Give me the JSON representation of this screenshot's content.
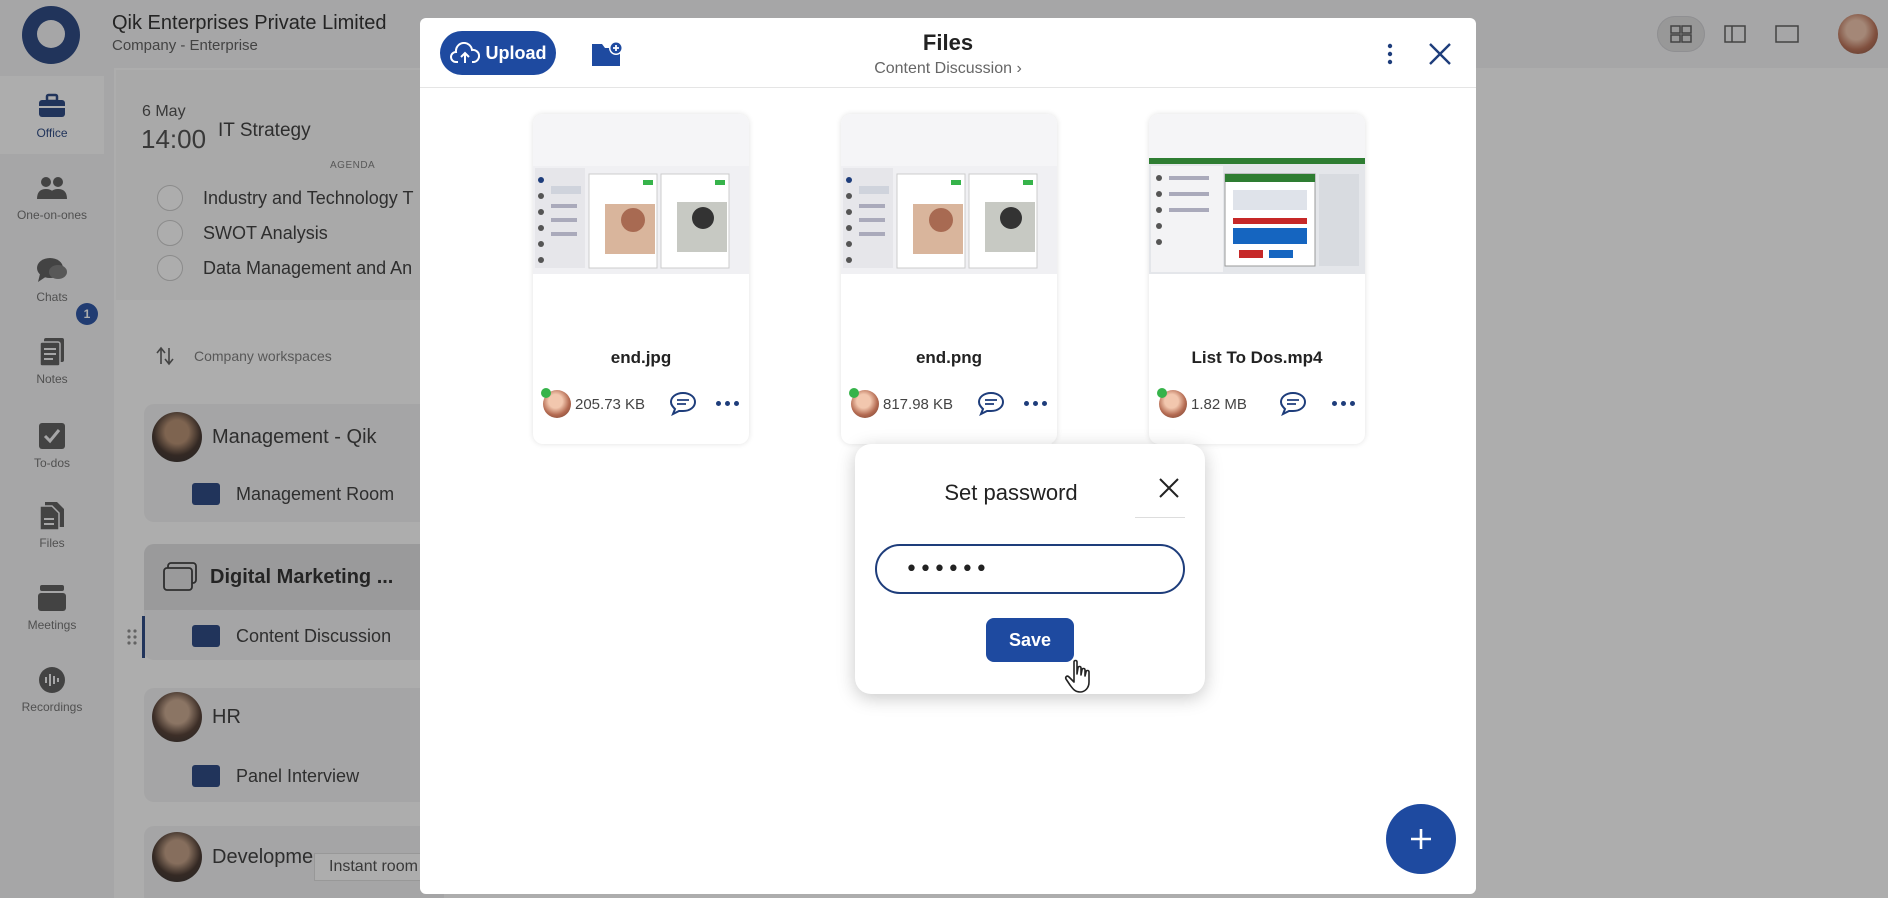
{
  "topbar": {
    "company_name": "Qik Enterprises Private Limited",
    "company_type": "Company - Enterprise",
    "view_icons": [
      "grid-view-icon",
      "sidebar-view-icon",
      "single-view-icon"
    ]
  },
  "sidebar": {
    "items": [
      {
        "label": "Office",
        "icon": "briefcase-icon"
      },
      {
        "label": "One-on-ones",
        "icon": "people-icon"
      },
      {
        "label": "Chats",
        "icon": "chat-icon"
      },
      {
        "label": "Notes",
        "icon": "notes-icon"
      },
      {
        "label": "To-dos",
        "icon": "todo-icon"
      },
      {
        "label": "Files",
        "icon": "files-icon"
      },
      {
        "label": "Meetings",
        "icon": "meetings-icon"
      },
      {
        "label": "Recordings",
        "icon": "recordings-icon"
      }
    ],
    "chat_badge": "1"
  },
  "meeting": {
    "day": "6 May",
    "time": "14:00",
    "title": "IT Strategy",
    "agenda_label": "AGENDA",
    "agenda": [
      "Industry and Technology T",
      "SWOT Analysis",
      "Data Management and An"
    ]
  },
  "workspaces": {
    "header": "Company workspaces",
    "cards": [
      {
        "name": "Management - Qik",
        "room": "Management Room"
      },
      {
        "name": "Digital Marketing ...",
        "room": "Content Discussion"
      },
      {
        "name": "HR",
        "room": "Panel Interview"
      },
      {
        "name": "Developme"
      }
    ],
    "instant_room": "Instant room"
  },
  "files_modal": {
    "upload_label": "Upload",
    "title": "Files",
    "breadcrumb": "Content Discussion ›",
    "files": [
      {
        "name": "end.jpg",
        "size": "205.73 KB"
      },
      {
        "name": "end.png",
        "size": "817.98 KB"
      },
      {
        "name": "List To Dos.mp4",
        "size": "1.82 MB"
      }
    ]
  },
  "password_popover": {
    "title": "Set password",
    "value": "••••••",
    "save_label": "Save"
  },
  "colors": {
    "brand": "#1e3d7b",
    "accent": "#1e4aa0",
    "online": "#36b34a"
  }
}
